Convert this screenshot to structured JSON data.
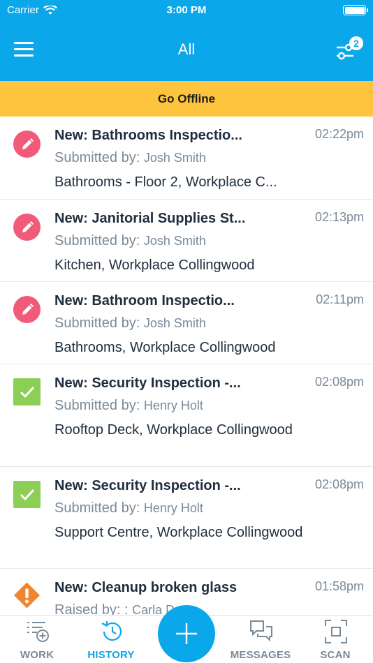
{
  "status_bar": {
    "carrier": "Carrier",
    "time": "3:00 PM"
  },
  "nav": {
    "title": "All",
    "filter_count": "2"
  },
  "offline": {
    "label": "Go Offline"
  },
  "items": [
    {
      "type": "pencil",
      "title": "New: Bathrooms Inspectio...",
      "time": "02:22pm",
      "sub_label": "Submitted by:",
      "person": "Josh Smith",
      "location": "Bathrooms - Floor 2, Workplace C..."
    },
    {
      "type": "pencil",
      "title": "New: Janitorial Supplies St...",
      "time": "02:13pm",
      "sub_label": "Submitted by:",
      "person": "Josh Smith",
      "location": "Kitchen, Workplace Collingwood"
    },
    {
      "type": "pencil",
      "title": "New: Bathroom Inspectio...",
      "time": "02:11pm",
      "sub_label": "Submitted by:",
      "person": "Josh Smith",
      "location": "Bathrooms, Workplace Collingwood"
    },
    {
      "type": "check",
      "title": "New: Security Inspection -...",
      "time": "02:08pm",
      "sub_label": "Submitted by:",
      "person": "Henry Holt",
      "location": "Rooftop Deck, Workplace Collingwood"
    },
    {
      "type": "check",
      "title": "New: Security Inspection -...",
      "time": "02:08pm",
      "sub_label": "Submitted by:",
      "person": "Henry Holt",
      "location": "Support Centre, Workplace Collingwood"
    },
    {
      "type": "warning",
      "title": "New: Cleanup broken glass",
      "time": "01:58pm",
      "sub_label": "Raised by: :",
      "person": "Carla D",
      "location": ""
    }
  ],
  "tabs": {
    "work": "WORK",
    "history": "HISTORY",
    "messages": "MESSAGES",
    "scan": "SCAN"
  },
  "colors": {
    "header": "#0aa7ea",
    "offline": "#ffc43d",
    "pencil": "#f25a79",
    "check": "#8ccf57",
    "warning": "#f0852d"
  }
}
